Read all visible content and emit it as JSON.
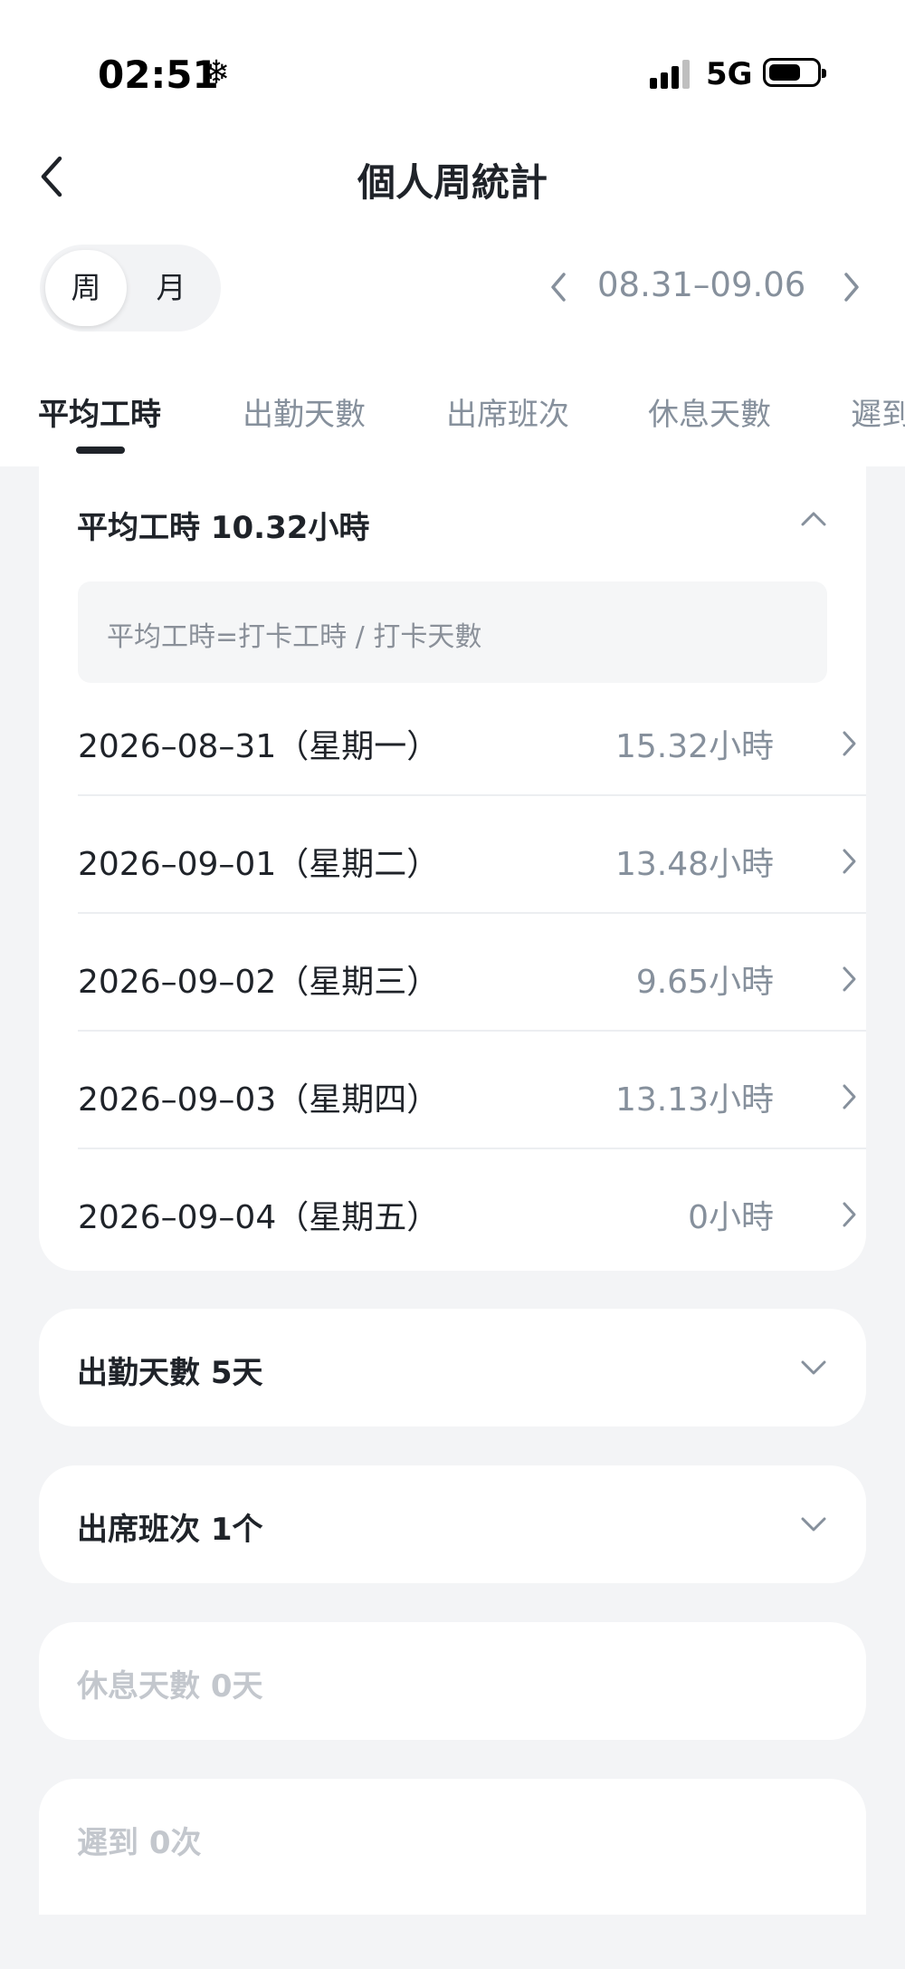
{
  "status_bar": {
    "time": "02:51",
    "extra_icon": "❄",
    "network": "5G",
    "signal_icon": "cellular-signal-icon",
    "battery_icon": "battery-icon"
  },
  "nav": {
    "title": "個人周統計",
    "back_icon": "chevron-left-icon"
  },
  "period_toggle": {
    "options": [
      "周",
      "月"
    ],
    "selected": "周"
  },
  "date_range": {
    "label": "08.31–09.06",
    "prev_icon": "chevron-left-icon",
    "next_icon": "chevron-right-icon"
  },
  "tabs": [
    {
      "label": "平均工時",
      "active": true
    },
    {
      "label": "出勤天數",
      "active": false
    },
    {
      "label": "出席班次",
      "active": false
    },
    {
      "label": "休息天數",
      "active": false
    },
    {
      "label": "遲到",
      "active": false
    }
  ],
  "avg_hours_card": {
    "title": "平均工時 10.32小時",
    "expanded": true,
    "formula": "平均工時=打卡工時 / 打卡天數",
    "rows": [
      {
        "date": "2026–08–31（星期一）",
        "value": "15.32小時"
      },
      {
        "date": "2026–09–01（星期二）",
        "value": "13.48小時"
      },
      {
        "date": "2026–09–02（星期三）",
        "value": "9.65小時"
      },
      {
        "date": "2026–09–03（星期四）",
        "value": "13.13小時"
      },
      {
        "date": "2026–09–04（星期五）",
        "value": "0小時"
      }
    ]
  },
  "attendance_days_card": {
    "title": "出勤天數 5天",
    "expanded": false
  },
  "shifts_card": {
    "title": "出席班次 1个",
    "expanded": false
  },
  "rest_days_card": {
    "title": "休息天數 0天"
  },
  "late_card": {
    "title": "遲到 0次"
  },
  "colors": {
    "background": "#f3f4f6",
    "card": "#ffffff",
    "primary_text": "#1f2329",
    "secondary_text": "#86909c",
    "disabled_text": "#c3c7cd"
  }
}
